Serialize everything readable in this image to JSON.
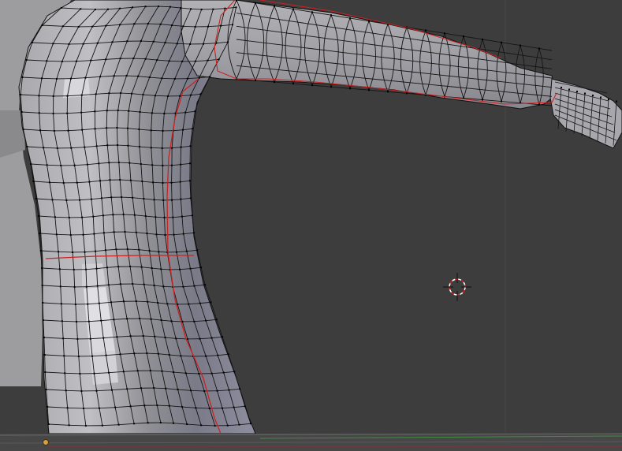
{
  "app": "Blender",
  "view": {
    "mode": "edit-mesh",
    "shading": "solid-wireframe",
    "object": "humanoid-base-mesh"
  },
  "colors": {
    "viewport_bg": "#3d3d3d",
    "mesh_face_light": "#b9b9bd",
    "mesh_face_mid": "#8e8e93",
    "mesh_face_dark": "#6c6c78",
    "back_mesh": "#9a9a9a",
    "edge": "#111111",
    "vertex": "#000000",
    "seam": "#cc2222",
    "cursor_red": "#d82020",
    "cursor_white": "#ffffff",
    "grid_line": "#4a4a4a"
  },
  "icons": {
    "cursor": "3d-cursor-icon",
    "origin": "object-origin-icon"
  }
}
